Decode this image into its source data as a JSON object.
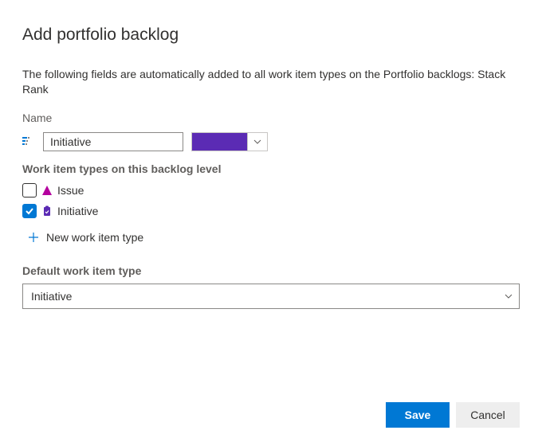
{
  "title": "Add portfolio backlog",
  "description": "The following fields are automatically added to all work item types on the Portfolio backlogs: Stack Rank",
  "name": {
    "label": "Name",
    "value": "Initiative",
    "color": "#5b2bb4"
  },
  "workItemTypes": {
    "label": "Work item types on this backlog level",
    "items": [
      {
        "label": "Issue",
        "checked": false,
        "iconColor": "#b4009e",
        "iconShape": "triangle"
      },
      {
        "label": "Initiative",
        "checked": true,
        "iconColor": "#5b2bb4",
        "iconShape": "clipboard"
      }
    ],
    "addLabel": "New work item type"
  },
  "defaultType": {
    "label": "Default work item type",
    "value": "Initiative"
  },
  "footer": {
    "save": "Save",
    "cancel": "Cancel"
  }
}
